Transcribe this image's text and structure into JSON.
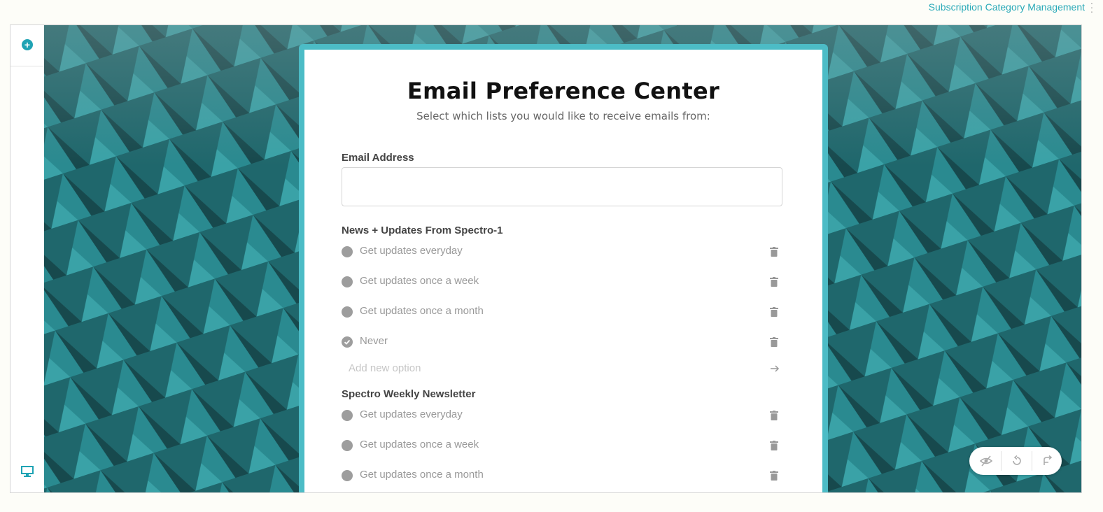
{
  "header": {
    "link_label": "Subscription Category Management",
    "menu_icon": "kebab-menu-icon"
  },
  "sidebar": {
    "add_icon": "plus-circle-icon",
    "device_icon": "desktop-icon"
  },
  "form": {
    "title": "Email Preference Center",
    "subtitle": "Select which lists you would like to receive emails from:",
    "email_label": "Email Address",
    "email_value": "",
    "groups": [
      {
        "title": "News + Updates From Spectro-1",
        "options": [
          {
            "label": "Get updates everyday",
            "checked": false
          },
          {
            "label": "Get updates once a week",
            "checked": false
          },
          {
            "label": "Get updates once a month",
            "checked": false
          },
          {
            "label": "Never",
            "checked": true
          }
        ],
        "add_placeholder": "Add new option"
      },
      {
        "title": "Spectro Weekly Newsletter",
        "options": [
          {
            "label": "Get updates everyday",
            "checked": false
          },
          {
            "label": "Get updates once a week",
            "checked": false
          },
          {
            "label": "Get updates once a month",
            "checked": false
          }
        ]
      }
    ]
  },
  "toolbar": {
    "icons": [
      "eye-slash-icon",
      "undo-icon",
      "redo-icon"
    ]
  },
  "colors": {
    "accent": "#29a9b8",
    "card_border": "#4cbcc6",
    "background": "#1e5d62"
  }
}
